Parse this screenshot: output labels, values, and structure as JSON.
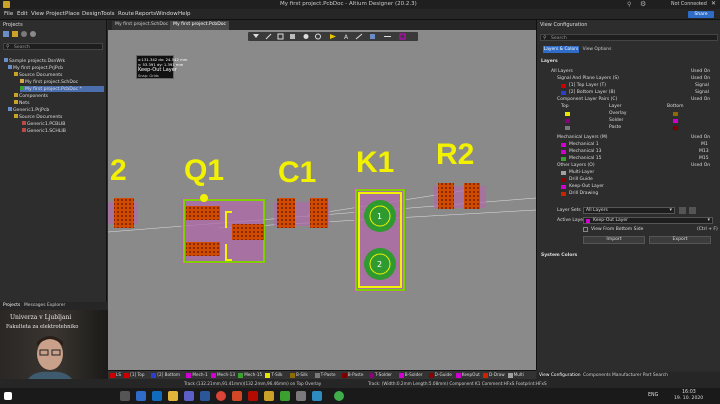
{
  "window": {
    "title": "My first project.PcbDoc - Altium Designer (20.2.3)",
    "signin": "Not Connected",
    "share_label": "Share"
  },
  "menu": [
    "File",
    "Edit",
    "View",
    "Project",
    "Place",
    "Design",
    "Tools",
    "Route",
    "Reports",
    "Window",
    "Help"
  ],
  "projects_panel": {
    "title": "Projects",
    "search_placeholder": "Search",
    "tree": [
      "Sample projects.DsnWrk",
      "My first project.PrjPcb",
      "Source Documents",
      "My first project.SchDoc",
      "My first project.PcbDoc *",
      "Components",
      "Nets",
      "Generic1.PrjPcb",
      "Source Documents",
      "Generic1.PCBLIB",
      "Generic1.SCHLIB"
    ],
    "bottom_tabs": [
      "Projects",
      "Messages",
      "Explorer"
    ]
  },
  "doc_tabs": [
    "My first project.SchDoc",
    "My first project.PcbDoc"
  ],
  "hud": {
    "xy": "x:131.342  dx: 24.542 mm",
    "y": "y: 53.391  dy: 1.391 mm",
    "layer": "Keep-Out Layer",
    "snap": "Snap: Grids"
  },
  "designators": [
    "2",
    "Q1",
    "C1",
    "K1",
    "R2"
  ],
  "pad_labels": [
    "1",
    "2"
  ],
  "view_config": {
    "title": "View Configuration",
    "tabs": [
      "Layers & Colors",
      "View Options"
    ],
    "search_placeholder": "Search",
    "section_layers": "Layers",
    "used_on": "Used On",
    "rows": [
      {
        "name": "All Layers",
        "used": "Used On",
        "color": ""
      },
      {
        "name": "Signal And Plane Layers (S)",
        "used": "Used On",
        "color": ""
      },
      {
        "name": "[1] Top Layer (T)",
        "used": "Signal",
        "color": "#cc0000"
      },
      {
        "name": "[2] Bottom Layer (B)",
        "used": "Signal",
        "color": "#2a3fd1"
      },
      {
        "name": "Component Layer Pairs (C)",
        "used": "Used On",
        "color": ""
      }
    ],
    "pair_headers": [
      "Top",
      "Layer",
      "Bottom"
    ],
    "pairs": [
      {
        "name": "Overlay",
        "top": "#e6e600",
        "bottom": "#8b6b00"
      },
      {
        "name": "Solder",
        "top": "#8b007a",
        "bottom": "#d100d1"
      },
      {
        "name": "Paste",
        "top": "#7a7a7a",
        "bottom": "#7a0000"
      }
    ],
    "mech_rows": [
      {
        "name": "Mechanical Layers (M)",
        "used": "Used On",
        "color": ""
      },
      {
        "name": "Mechanical 1",
        "used": "M1",
        "color": "#d100d1"
      },
      {
        "name": "Mechanical 13",
        "used": "M13",
        "color": "#d100d1"
      },
      {
        "name": "Mechanical 15",
        "used": "M15",
        "color": "#3aa02f"
      },
      {
        "name": "Other Layers (O)",
        "used": "Used On",
        "color": ""
      },
      {
        "name": "Multi-Layer",
        "used": "",
        "color": "#a0a0a0"
      },
      {
        "name": "Drill Guide",
        "used": "",
        "color": "#8b0000"
      },
      {
        "name": "Keep-Out Layer",
        "used": "",
        "color": "#d100d1"
      },
      {
        "name": "Drill Drawing",
        "used": "",
        "color": "#cc2200"
      }
    ],
    "layer_sets_label": "Layer Sets",
    "layer_sets_value": "All Layers",
    "active_layer_label": "Active Layer",
    "active_layer_value": "Keep-Out Layer",
    "view_from_bottom": "View From Bottom Side",
    "shortcut": "(Ctrl + F)",
    "import": "Import",
    "export": "Export",
    "system_colors": "System Colors",
    "bottom_tabs": [
      "View Configuration",
      "Components",
      "Manufacturer Part Search"
    ]
  },
  "layer_bar": [
    {
      "label": "LS",
      "color": "#cc0000"
    },
    {
      "label": "[1] Top",
      "color": "#cc0000"
    },
    {
      "label": "[2] Bottom",
      "color": "#2a3fd1"
    },
    {
      "label": "Mech-1",
      "color": "#d100d1"
    },
    {
      "label": "Mech-13",
      "color": "#d100d1"
    },
    {
      "label": "Mech-15",
      "color": "#3aa02f"
    },
    {
      "label": "T-Silk",
      "color": "#e6e600"
    },
    {
      "label": "B-Silk",
      "color": "#8b6b00"
    },
    {
      "label": "T-Paste",
      "color": "#7a7a7a"
    },
    {
      "label": "B-Paste",
      "color": "#7a0000"
    },
    {
      "label": "T-Solder",
      "color": "#8b007a"
    },
    {
      "label": "B-Solder",
      "color": "#d100d1"
    },
    {
      "label": "D-Guide",
      "color": "#8b0000"
    },
    {
      "label": "KeepOut",
      "color": "#d100d1"
    },
    {
      "label": "D-Draw",
      "color": "#cc2200"
    },
    {
      "label": "Multi",
      "color": "#a0a0a0"
    }
  ],
  "status": {
    "left": "Track (132.21mm,91.41mm)(132.2mm,96.46mm) on Top Overlay",
    "right": "Track: (Width:0.2mm Length:5.08mm)   Component K1 Comment:HFxS Footprint:HFxS"
  },
  "taskbar": {
    "lang": "ENG",
    "time": "16:03",
    "date": "19. 10. 2020"
  },
  "webcam": {
    "line1": "Univerza v Ljubljani",
    "line2": "Fakulteta za elektrotehniko"
  }
}
